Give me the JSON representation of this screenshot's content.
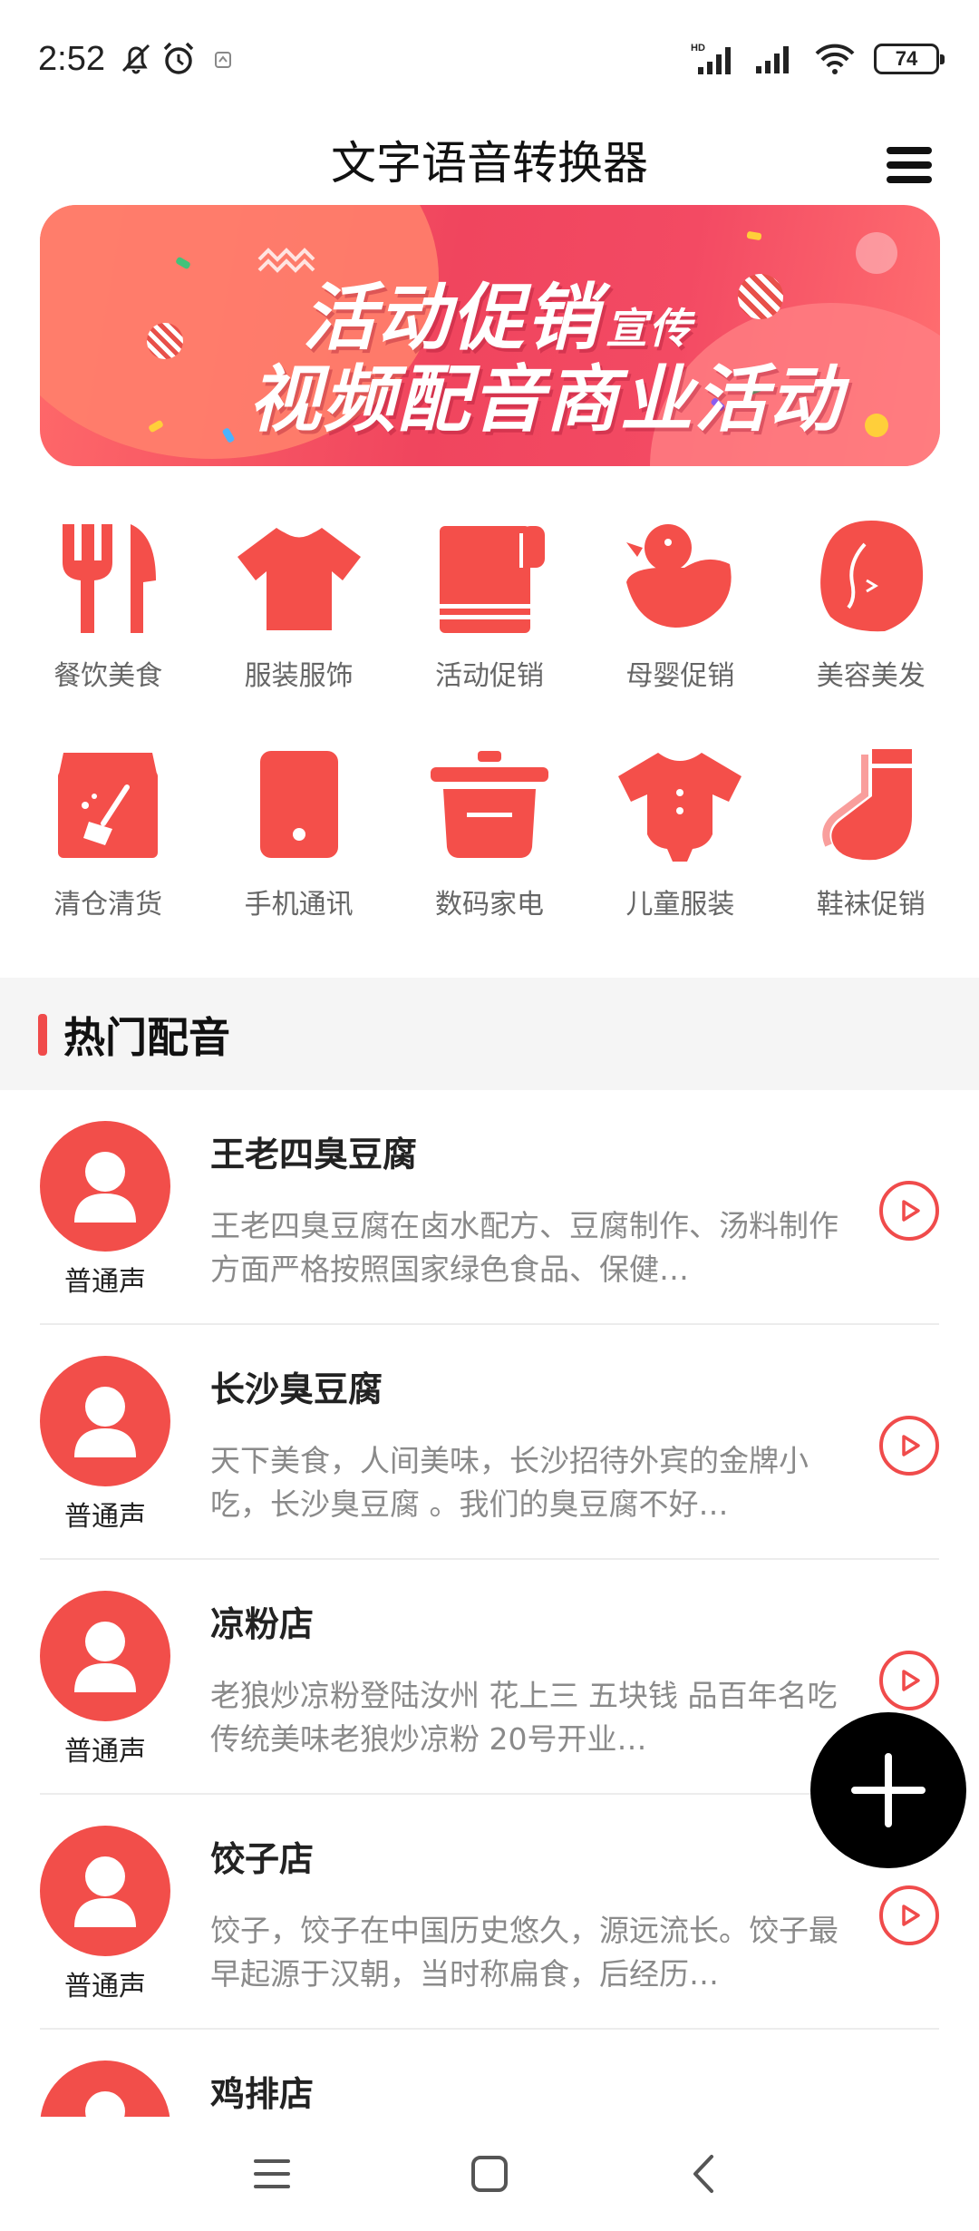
{
  "status_bar": {
    "time": "2:52",
    "battery": "74",
    "icons": [
      "mute-bell-icon",
      "alarm-icon",
      "notification-icon",
      "hd-signal-icon",
      "signal-icon",
      "wifi-icon",
      "battery-icon"
    ]
  },
  "header": {
    "title": "文字语音转换器",
    "menu_icon": "hamburger-menu-icon"
  },
  "banner": {
    "line1": "活动促销",
    "line1_small": "宣传",
    "line2": "视频配音商业活动"
  },
  "categories": [
    {
      "label": "餐饮美食",
      "icon": "fork-knife-icon"
    },
    {
      "label": "服装服饰",
      "icon": "tshirt-icon"
    },
    {
      "label": "活动促销",
      "icon": "towel-icon"
    },
    {
      "label": "母婴促销",
      "icon": "duck-icon"
    },
    {
      "label": "美容美发",
      "icon": "woman-hair-icon"
    },
    {
      "label": "清仓清货",
      "icon": "box-broom-icon"
    },
    {
      "label": "手机通讯",
      "icon": "phone-icon"
    },
    {
      "label": "数码家电",
      "icon": "pot-icon"
    },
    {
      "label": "儿童服装",
      "icon": "baby-onesie-icon"
    },
    {
      "label": "鞋袜促销",
      "icon": "sock-icon"
    }
  ],
  "section": {
    "title": "热门配音"
  },
  "items": [
    {
      "title": "王老四臭豆腐",
      "desc": "王老四臭豆腐在卤水配方、豆腐制作、汤料制作方面严格按照国家绿色食品、保健…",
      "voice": "普通声"
    },
    {
      "title": "长沙臭豆腐",
      "desc": "天下美食，人间美味，长沙招待外宾的金牌小吃，长沙臭豆腐 。我们的臭豆腐不好…",
      "voice": "普通声"
    },
    {
      "title": "凉粉店",
      "desc": "老狼炒凉粉登陆汝州 花上三 五块钱 品百年名吃 传统美味老狼炒凉粉 20号开业…",
      "voice": "普通声"
    },
    {
      "title": "饺子店",
      "desc": "饺子，饺子在中国历史悠久，源远流长。饺子最早起源于汉朝，当时称扁食，后经历…",
      "voice": "普通声"
    },
    {
      "title": "鸡排店",
      "desc": "",
      "voice": ""
    }
  ],
  "colors": {
    "accent": "#f04b4b",
    "icon_red": "#f44f4a",
    "fab": "#000000"
  },
  "navbar": {
    "icons": [
      "menu-icon",
      "home-square-icon",
      "back-icon"
    ]
  },
  "fab": {
    "icon": "plus-icon"
  }
}
